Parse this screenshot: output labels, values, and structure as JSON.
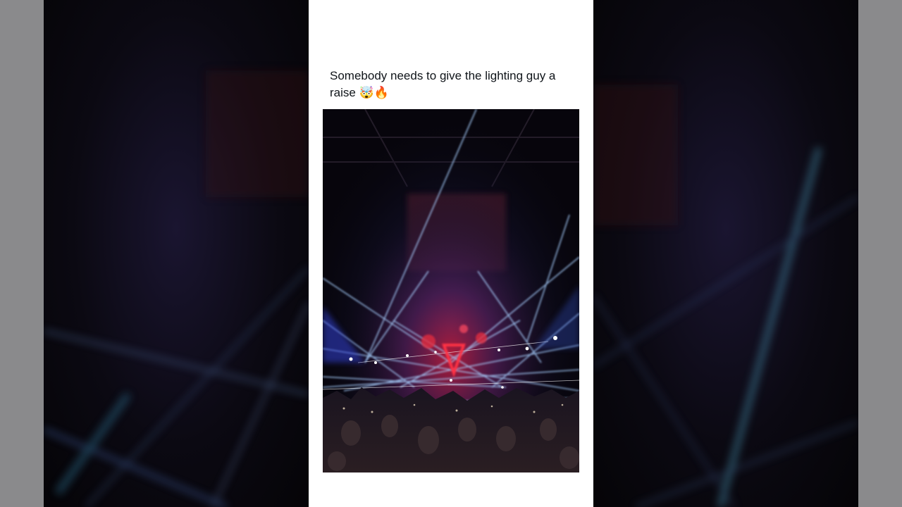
{
  "post": {
    "caption": "Somebody needs to give the lighting guy a raise 🤯🔥"
  },
  "media": {
    "type": "video-frame",
    "subject": "concert-laser-light-show"
  },
  "colors": {
    "card_background": "#ffffff",
    "caption_text": "#0f1419",
    "page_background": "#050308",
    "side_edges": "#8a8a8c",
    "laser": "#9ec8ff",
    "stage_glow": "#e0203a"
  }
}
